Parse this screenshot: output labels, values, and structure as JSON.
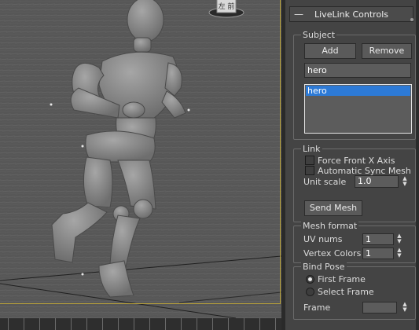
{
  "panel": {
    "title": "LiveLink Controls",
    "subject": {
      "label": "Subject",
      "add_label": "Add",
      "remove_label": "Remove",
      "name_value": "hero",
      "list": [
        "hero"
      ]
    },
    "link": {
      "label": "Link",
      "force_front_x": "Force Front X Axis",
      "auto_sync": "Automatic Sync Mesh",
      "unit_scale_label": "Unit scale",
      "unit_scale_value": "1.0",
      "send_mesh_label": "Send Mesh"
    },
    "mesh_format": {
      "label": "Mesh format",
      "uv_nums_label": "UV nums",
      "uv_nums_value": "1",
      "vertex_colors_label": "Vertex Colors",
      "vertex_colors_value": "1"
    },
    "bind_pose": {
      "label": "Bind Pose",
      "first_frame": "First Frame",
      "select_frame": "Select Frame",
      "frame_label": "Frame",
      "frame_value": ""
    }
  },
  "viewcube_label": "左 前"
}
